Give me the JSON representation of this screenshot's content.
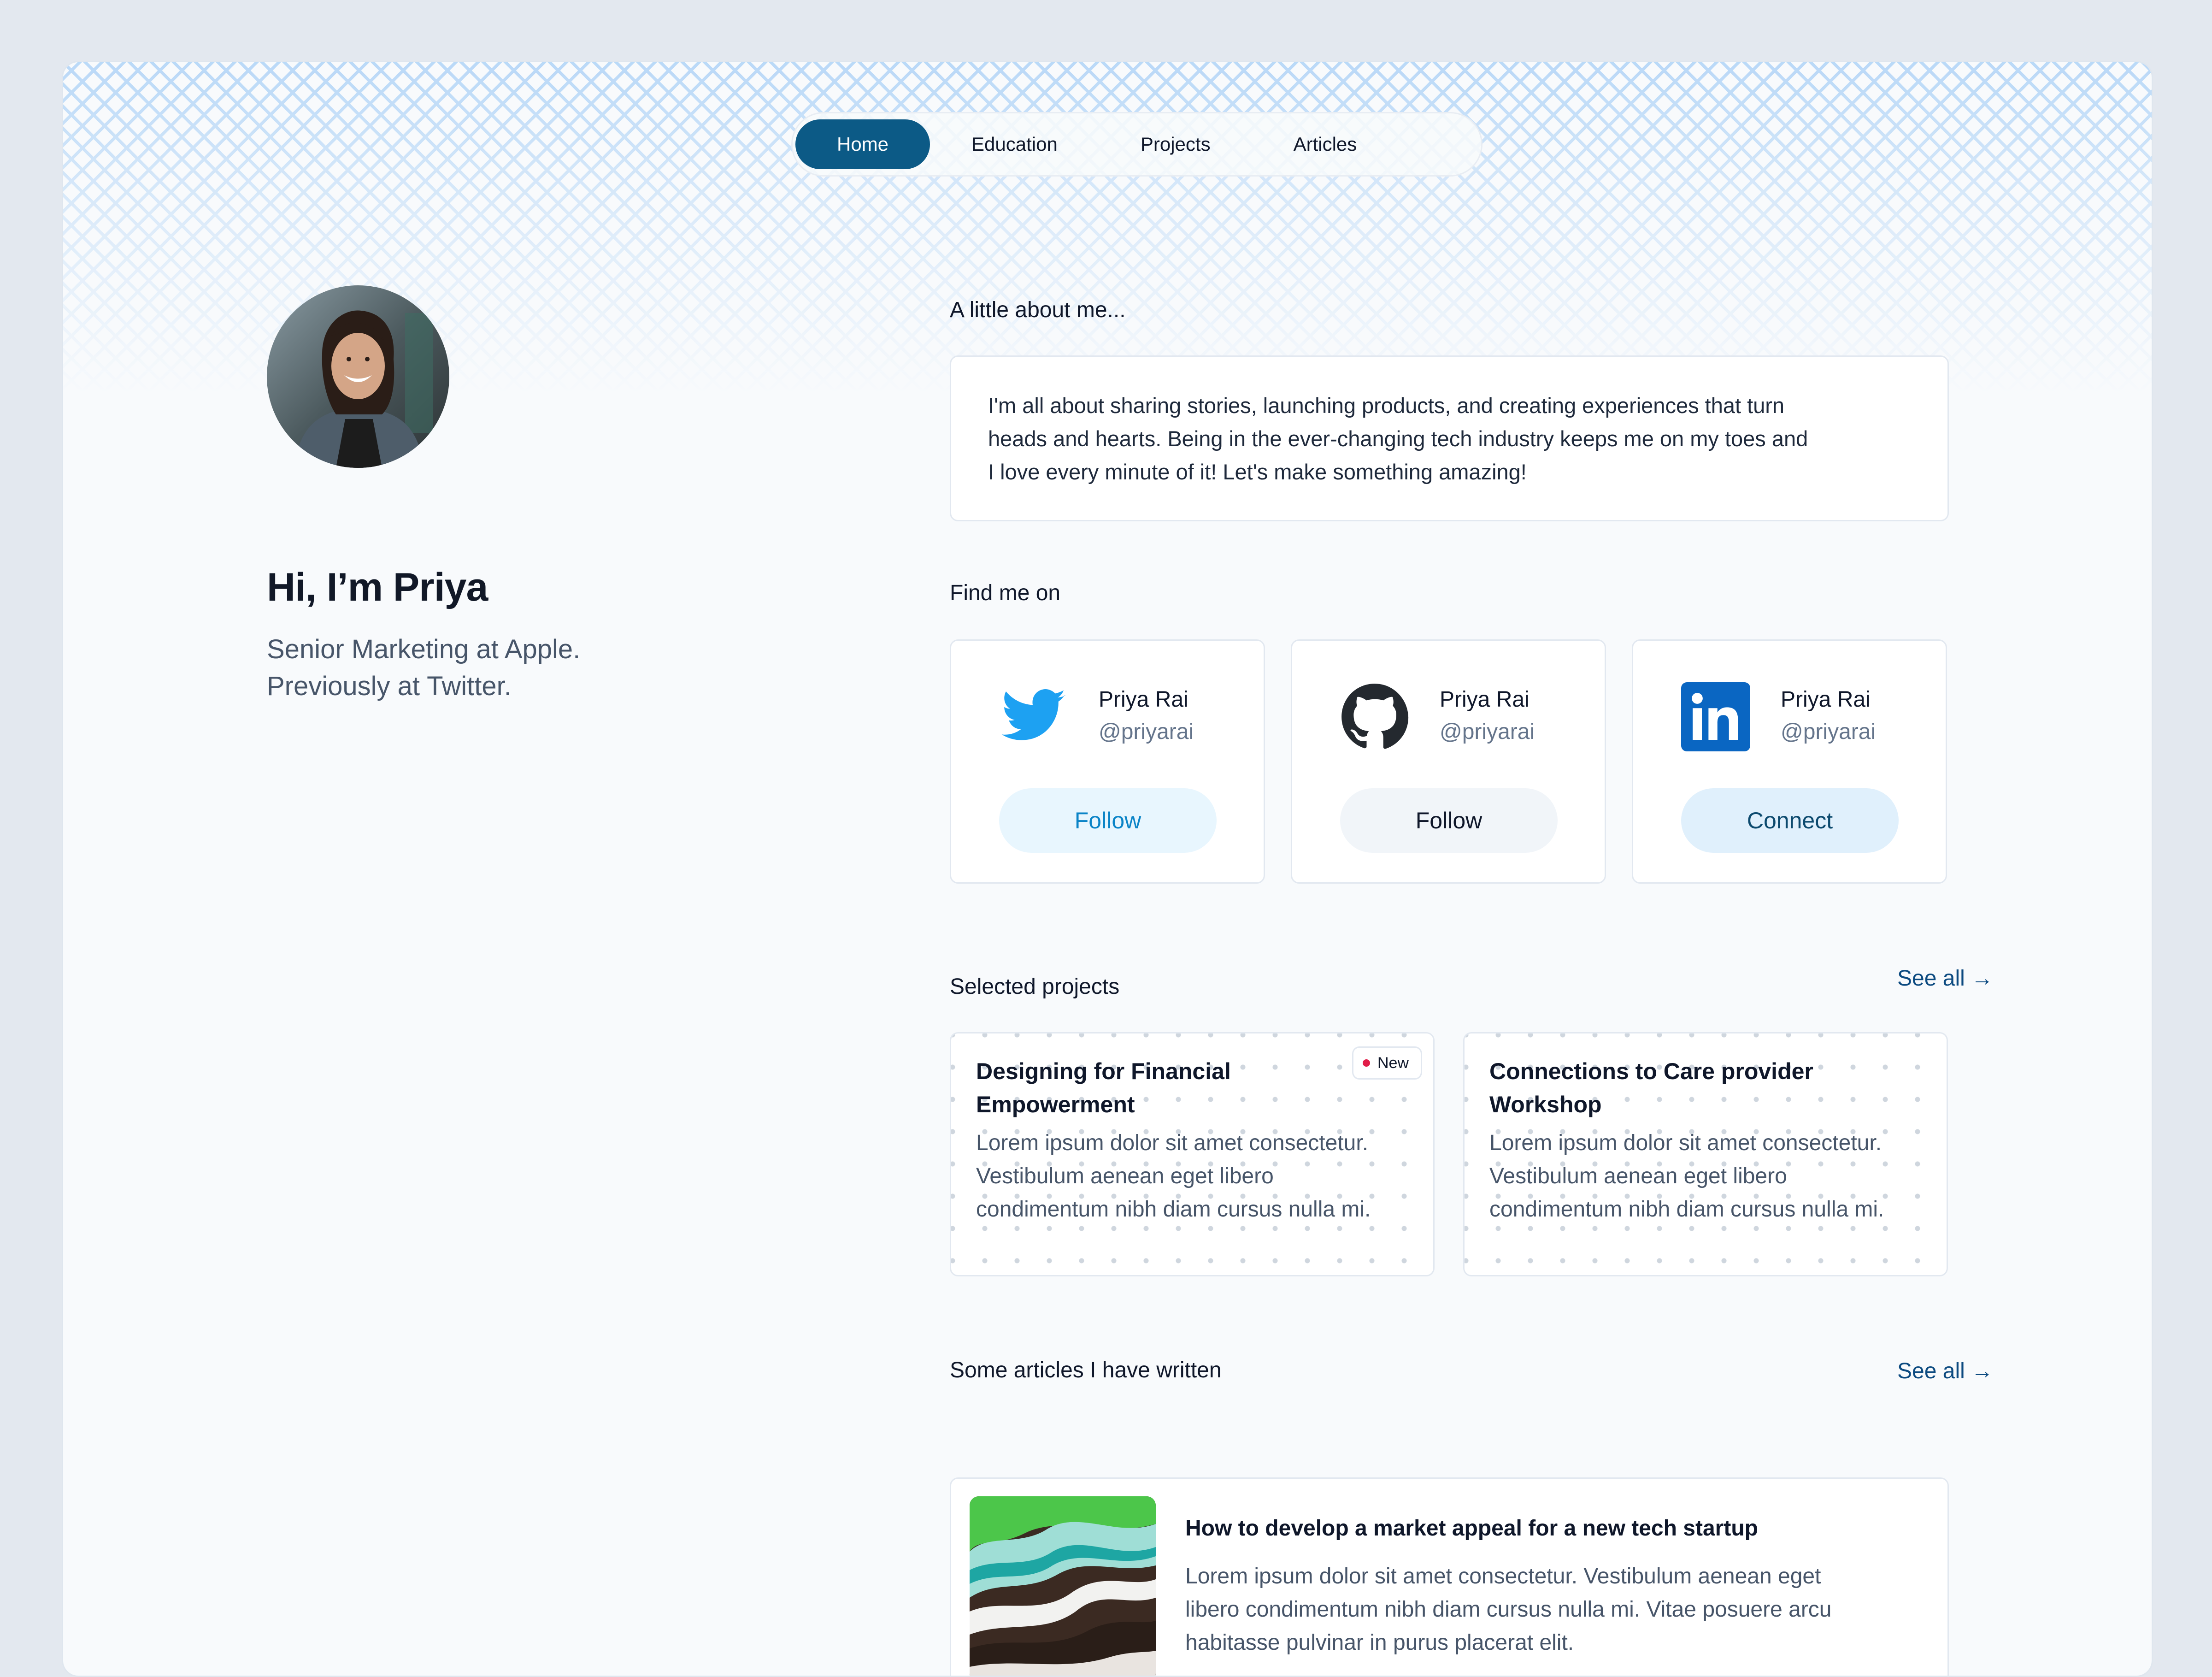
{
  "nav": {
    "items": [
      {
        "label": "Home",
        "active": true
      },
      {
        "label": "Education",
        "active": false
      },
      {
        "label": "Projects",
        "active": false
      },
      {
        "label": "Articles",
        "active": false
      }
    ]
  },
  "profile": {
    "greeting": "Hi, I’m Priya",
    "bio_line1": "Senior Marketing at Apple.",
    "bio_line2": "Previously at Twitter."
  },
  "about": {
    "heading": "A little about me...",
    "lines": [
      "I'm all about sharing stories, launching products, and creating experiences that turn",
      "heads and hearts. Being in the ever-changing tech industry keeps me on my toes and",
      "I love every minute of it! Let's make something amazing!"
    ]
  },
  "social": {
    "heading": "Find me on",
    "cards": [
      {
        "icon": "twitter-icon",
        "name": "Priya Rai",
        "handle": "@priyarai",
        "button": "Follow",
        "color": "#1da1f2"
      },
      {
        "icon": "github-icon",
        "name": "Priya Rai",
        "handle": "@priyarai",
        "button": "Follow",
        "color": "#24292f"
      },
      {
        "icon": "linkedin-icon",
        "name": "Priya Rai",
        "handle": "@priyarai",
        "button": "Connect",
        "color": "#0a66c2"
      }
    ]
  },
  "projects": {
    "heading": "Selected projects",
    "see_all": "See all →",
    "items": [
      {
        "title_line1": "Designing for Financial",
        "title_line2": "Empowerment",
        "desc_lines": [
          "Lorem ipsum dolor sit amet consectetur.",
          "Vestibulum aenean eget libero",
          "condimentum nibh diam cursus nulla mi."
        ],
        "badge": "New"
      },
      {
        "title_line1": "Connections to Care provider",
        "title_line2": "Workshop",
        "desc_lines": [
          "Lorem ipsum dolor sit amet consectetur.",
          "Vestibulum aenean eget libero",
          "condimentum nibh diam cursus nulla mi."
        ]
      }
    ]
  },
  "articles": {
    "heading": "Some articles I have written",
    "see_all": "See all →",
    "items": [
      {
        "title": "How to develop a market appeal for a new tech startup",
        "desc_lines": [
          "Lorem ipsum dolor sit amet consectetur. Vestibulum aenean eget",
          "libero condimentum nibh diam cursus nulla mi. Vitae posuere arcu",
          "habitasse pulvinar in purus placerat elit."
        ]
      }
    ]
  }
}
